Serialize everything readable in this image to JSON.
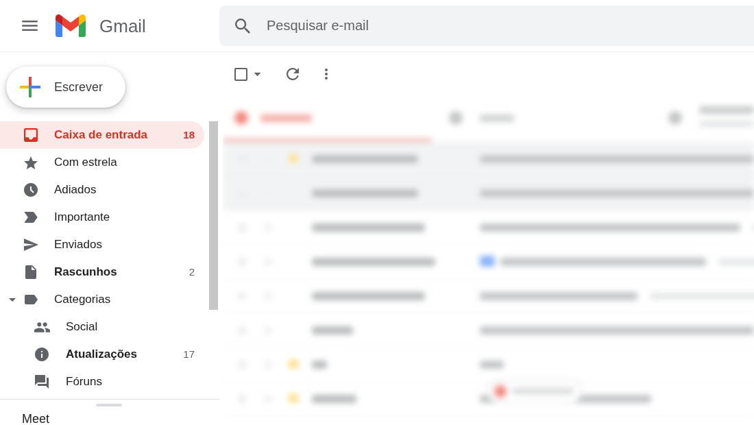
{
  "header": {
    "app_name": "Gmail",
    "search": {
      "placeholder": "Pesquisar e-mail"
    }
  },
  "sidebar": {
    "compose_button": {
      "label": "Escrever"
    },
    "items": [
      {
        "label": "Caixa de entrada",
        "count": "18",
        "selected": true,
        "unread": true
      },
      {
        "label": "Com estrela",
        "selected": false,
        "unread": false
      },
      {
        "label": "Adiados",
        "selected": false,
        "unread": false
      },
      {
        "label": "Importante",
        "selected": false,
        "unread": false
      },
      {
        "label": "Enviados",
        "selected": false,
        "unread": false
      },
      {
        "label": "Rascunhos",
        "count": "2",
        "selected": false,
        "unread": true
      },
      {
        "label": "Categorias",
        "selected": false,
        "unread": false,
        "expanded": true,
        "children": [
          {
            "label": "Social",
            "selected": false,
            "unread": false
          },
          {
            "label": "Atualizações",
            "count": "17",
            "selected": false,
            "unread": true
          },
          {
            "label": "Fóruns",
            "selected": false,
            "unread": false
          }
        ]
      }
    ],
    "meet": {
      "title": "Meet"
    }
  },
  "toolbar": {
    "select_all": {
      "checked": false
    }
  }
}
